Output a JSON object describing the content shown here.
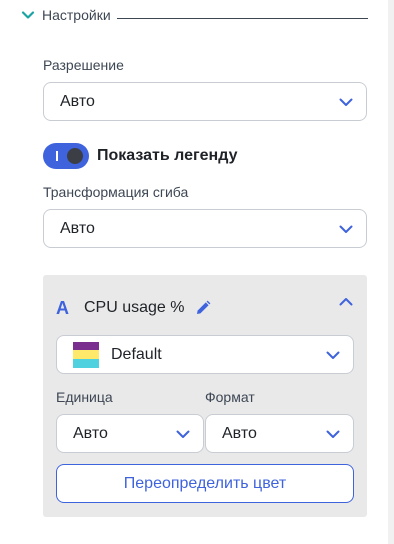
{
  "section": {
    "title": "Настройки"
  },
  "resolution": {
    "label": "Разрешение",
    "value": "Авто"
  },
  "legend": {
    "label": "Показать легенду",
    "checked": true
  },
  "bend": {
    "label": "Трансформация сгиба",
    "value": "Авто"
  },
  "series": {
    "letter": "A",
    "name": "CPU usage %",
    "palette": {
      "value": "Default",
      "colors": [
        "#7a2e8e",
        "#ffe96b",
        "#4fd1e0"
      ]
    },
    "unit": {
      "label": "Единица",
      "value": "Авто"
    },
    "format": {
      "label": "Формат",
      "value": "Авто"
    },
    "override_label": "Переопределить цвет"
  },
  "colors": {
    "accent": "#3e63dd",
    "toggle_bg": "#3e63dd",
    "panel_bg": "#e9e9e9"
  }
}
